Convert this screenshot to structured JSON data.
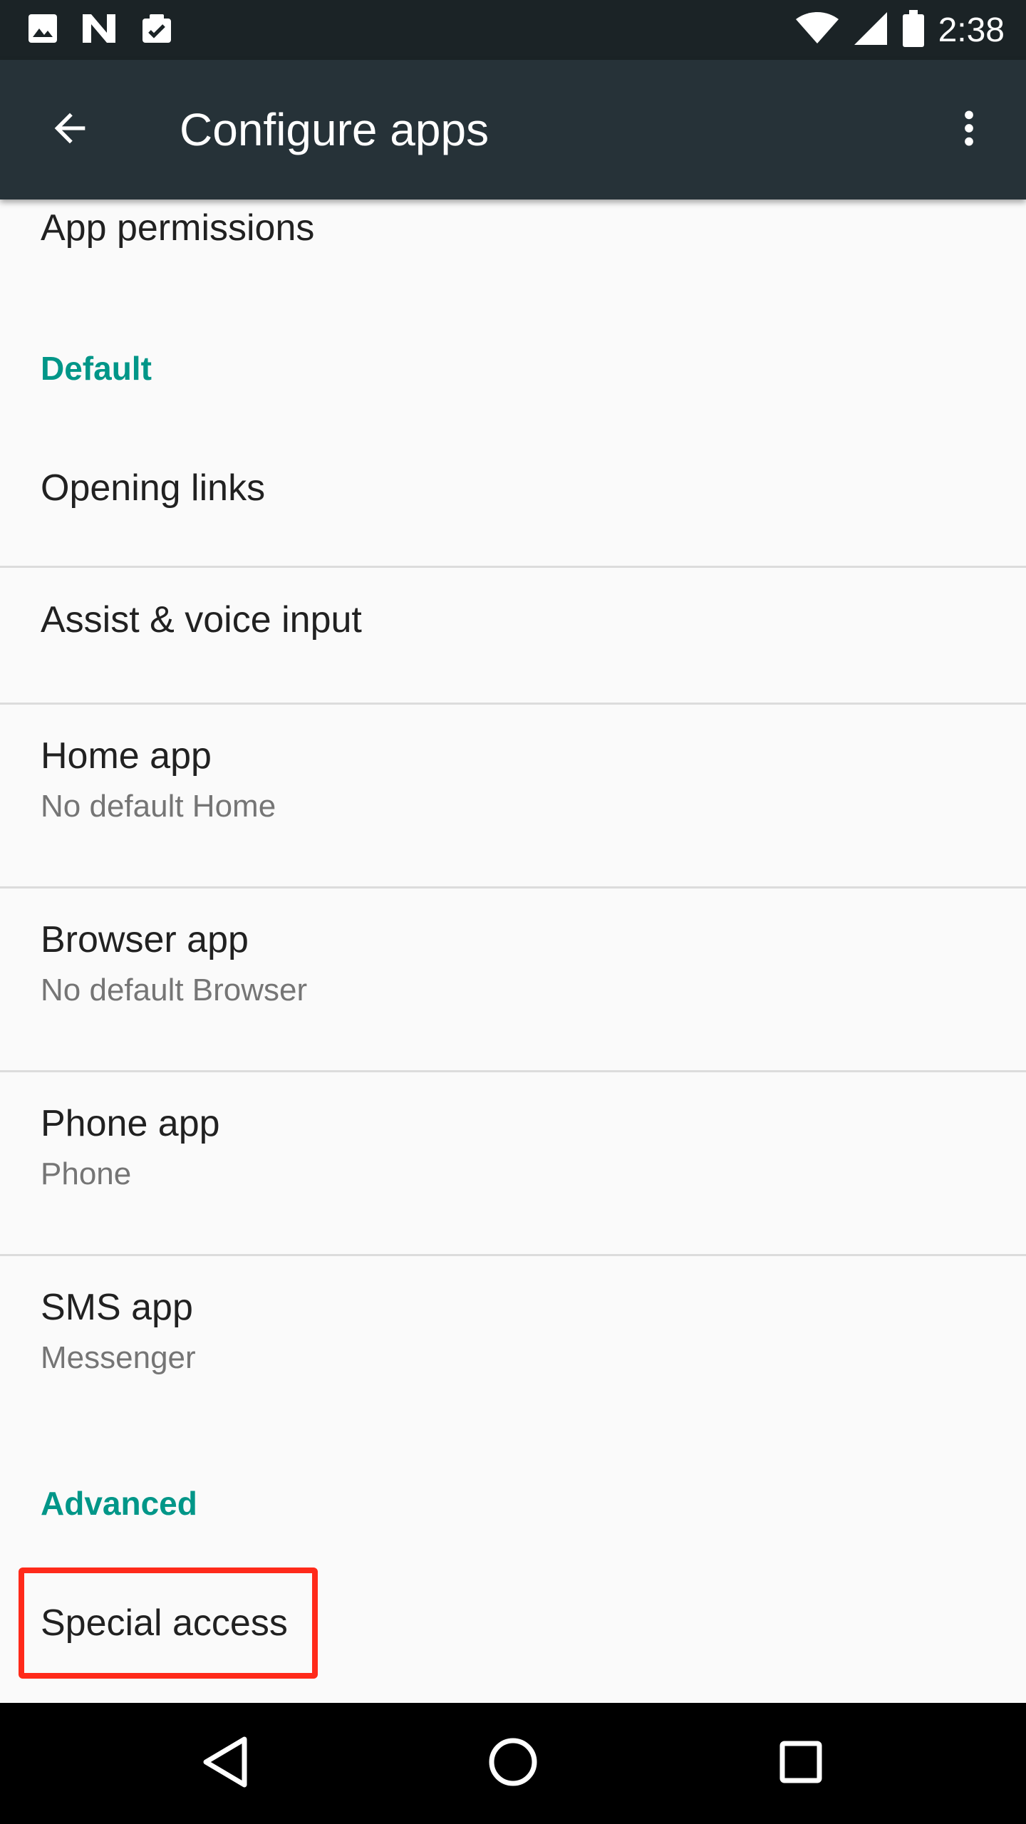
{
  "status_bar": {
    "time": "2:38",
    "icons": [
      "image-icon",
      "n-notification-icon",
      "clipboard-check-icon",
      "wifi-icon",
      "signal-icon",
      "battery-icon"
    ]
  },
  "app_bar": {
    "title": "Configure apps",
    "back_icon": "arrow-back-icon",
    "menu_icon": "more-vert-icon"
  },
  "list": {
    "app_permissions": {
      "title": "App permissions"
    },
    "category_default": "Default",
    "opening_links": {
      "title": "Opening links"
    },
    "assist_voice": {
      "title": "Assist & voice input"
    },
    "home_app": {
      "title": "Home app",
      "summary": "No default Home"
    },
    "browser_app": {
      "title": "Browser app",
      "summary": "No default Browser"
    },
    "phone_app": {
      "title": "Phone app",
      "summary": "Phone"
    },
    "sms_app": {
      "title": "SMS app",
      "summary": "Messenger"
    },
    "category_advanced": "Advanced",
    "special_access": {
      "title": "Special access"
    }
  },
  "nav_bar": {
    "icons": [
      "back-triangle-icon",
      "home-circle-icon",
      "recents-square-icon"
    ]
  },
  "colors": {
    "status_bar": "#1b2326",
    "app_bar": "#263238",
    "accent": "#009688",
    "highlight": "#ff2a1a"
  }
}
